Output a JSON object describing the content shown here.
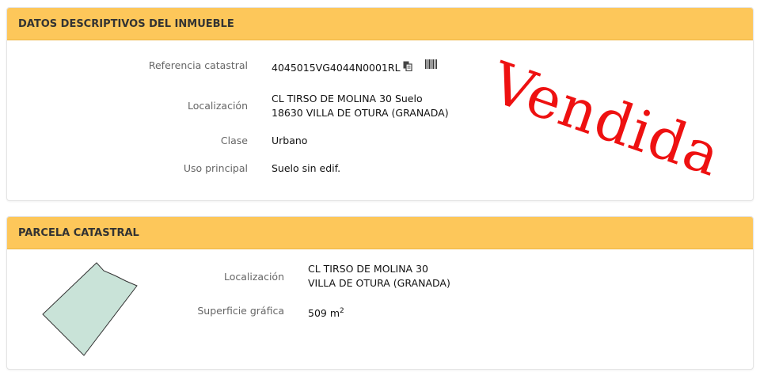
{
  "inmueble": {
    "title": "DATOS DESCRIPTIVOS DEL INMUEBLE",
    "referencia_label": "Referencia catastral",
    "referencia_value": "4045015VG4044N0001RL",
    "localizacion_label": "Localización",
    "localizacion_line1": "CL TIRSO DE MOLINA 30 Suelo",
    "localizacion_line2": "18630 VILLA DE OTURA (GRANADA)",
    "clase_label": "Clase",
    "clase_value": "Urbano",
    "uso_label": "Uso principal",
    "uso_value": "Suelo sin edif.",
    "stamp": "Vendida"
  },
  "parcela": {
    "title": "PARCELA CATASTRAL",
    "localizacion_label": "Localización",
    "localizacion_line1": "CL TIRSO DE MOLINA 30",
    "localizacion_line2": "VILLA DE OTURA (GRANADA)",
    "superficie_label": "Superficie gráfica",
    "superficie_value": "509 m",
    "superficie_unit_exp": "2"
  },
  "colors": {
    "header": "#fdc75a",
    "stamp": "#ee1111",
    "parcel_fill": "#c9e3d8"
  },
  "icons": [
    "copy-icon",
    "barcode-icon"
  ]
}
